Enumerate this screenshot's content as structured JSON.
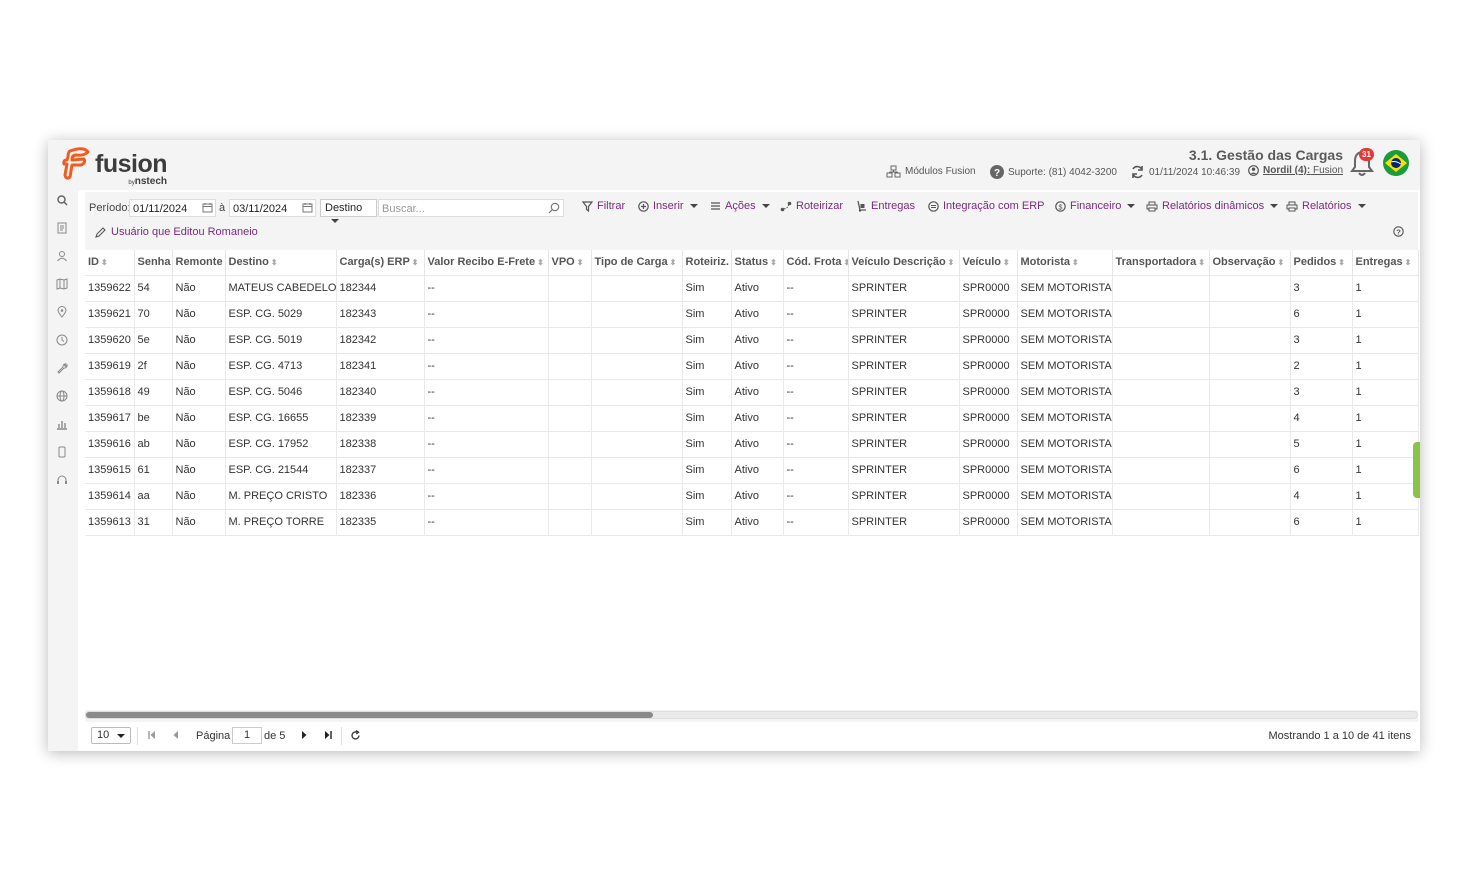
{
  "header": {
    "brand": "fusion",
    "brand_by": "by",
    "brand_sub": "nstech",
    "page_title": "3.1. Gestão das Cargas",
    "modules_label": "Módulos Fusion",
    "support_label": "Suporte: (81) 4042-3200",
    "datetime": "01/11/2024 10:46:39",
    "user_name": "Nordil (4):",
    "user_app": "Fusion",
    "notification_count": "31"
  },
  "sidebar": {
    "icons": [
      "search-icon",
      "document-icon",
      "users-icon",
      "map-icon",
      "location-pin-icon",
      "clock-icon",
      "wrench-icon",
      "globe-icon",
      "bar-chart-icon",
      "mobile-icon",
      "headset-icon"
    ]
  },
  "toolbar": {
    "period_label": "Período:",
    "date_from": "01/11/2024",
    "separator": "à",
    "date_to": "03/11/2024",
    "filter_field": "Destino",
    "search_placeholder": "Buscar...",
    "filtrar": "Filtrar",
    "inserir": "Inserir",
    "acoes": "Ações",
    "roteirizar": "Roteirizar",
    "entregas": "Entregas",
    "integracao": "Integração com ERP",
    "financeiro": "Financeiro",
    "relatorios_dinamicos": "Relatórios dinâmicos",
    "relatorios": "Relatórios",
    "edited_link": "Usuário que Editou Romaneio"
  },
  "table": {
    "columns": [
      "ID",
      "Senha",
      "Remonte",
      "Destino",
      "Carga(s) ERP",
      "Valor Recibo E-Frete",
      "VPO",
      "Tipo de Carga",
      "Roteiriz.",
      "Status",
      "Cód. Frota",
      "Veículo Descrição",
      "Veículo",
      "Motorista",
      "Transportadora",
      "Observação",
      "Pedidos",
      "Entregas"
    ],
    "rows": [
      [
        "1359622",
        "54",
        "Não",
        "MATEUS CABEDELO",
        "182344",
        "--",
        "",
        "",
        "Sim",
        "Ativo",
        "--",
        "SPRINTER",
        "SPR0000",
        "SEM MOTORISTA",
        "",
        "",
        "3",
        "1"
      ],
      [
        "1359621",
        "70",
        "Não",
        "ESP. CG. 5029",
        "182343",
        "--",
        "",
        "",
        "Sim",
        "Ativo",
        "--",
        "SPRINTER",
        "SPR0000",
        "SEM MOTORISTA",
        "",
        "",
        "6",
        "1"
      ],
      [
        "1359620",
        "5e",
        "Não",
        "ESP. CG. 5019",
        "182342",
        "--",
        "",
        "",
        "Sim",
        "Ativo",
        "--",
        "SPRINTER",
        "SPR0000",
        "SEM MOTORISTA",
        "",
        "",
        "3",
        "1"
      ],
      [
        "1359619",
        "2f",
        "Não",
        "ESP. CG. 4713",
        "182341",
        "--",
        "",
        "",
        "Sim",
        "Ativo",
        "--",
        "SPRINTER",
        "SPR0000",
        "SEM MOTORISTA",
        "",
        "",
        "2",
        "1"
      ],
      [
        "1359618",
        "49",
        "Não",
        "ESP. CG. 5046",
        "182340",
        "--",
        "",
        "",
        "Sim",
        "Ativo",
        "--",
        "SPRINTER",
        "SPR0000",
        "SEM MOTORISTA",
        "",
        "",
        "3",
        "1"
      ],
      [
        "1359617",
        "be",
        "Não",
        "ESP. CG. 16655",
        "182339",
        "--",
        "",
        "",
        "Sim",
        "Ativo",
        "--",
        "SPRINTER",
        "SPR0000",
        "SEM MOTORISTA",
        "",
        "",
        "4",
        "1"
      ],
      [
        "1359616",
        "ab",
        "Não",
        "ESP. CG. 17952",
        "182338",
        "--",
        "",
        "",
        "Sim",
        "Ativo",
        "--",
        "SPRINTER",
        "SPR0000",
        "SEM MOTORISTA",
        "",
        "",
        "5",
        "1"
      ],
      [
        "1359615",
        "61",
        "Não",
        "ESP. CG. 21544",
        "182337",
        "--",
        "",
        "",
        "Sim",
        "Ativo",
        "--",
        "SPRINTER",
        "SPR0000",
        "SEM MOTORISTA",
        "",
        "",
        "6",
        "1"
      ],
      [
        "1359614",
        "aa",
        "Não",
        "M. PREÇO CRISTO",
        "182336",
        "--",
        "",
        "",
        "Sim",
        "Ativo",
        "--",
        "SPRINTER",
        "SPR0000",
        "SEM MOTORISTA",
        "",
        "",
        "4",
        "1"
      ],
      [
        "1359613",
        "31",
        "Não",
        "M. PREÇO TORRE",
        "182335",
        "--",
        "",
        "",
        "Sim",
        "Ativo",
        "--",
        "SPRINTER",
        "SPR0000",
        "SEM MOTORISTA",
        "",
        "",
        "6",
        "1"
      ]
    ]
  },
  "pager": {
    "page_size": "10",
    "page_label": "Página",
    "page_value": "1",
    "page_of": "de 5",
    "summary": "Mostrando 1 a 10 de 41 itens"
  },
  "colors": {
    "accent": "#7b2a7e",
    "brand_orange": "#f25a1f",
    "badge": "#e53935",
    "green_tab": "#8bc34a"
  }
}
